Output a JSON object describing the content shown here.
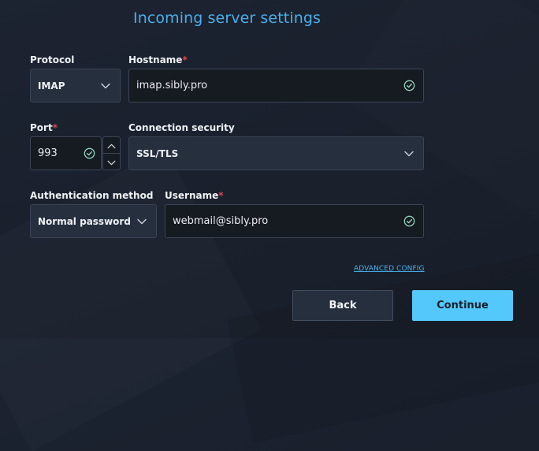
{
  "form": {
    "title": "Incoming server settings",
    "protocol": {
      "label": "Protocol",
      "value": "IMAP",
      "icon": "chevron-down-icon"
    },
    "hostname": {
      "label": "Hostname",
      "required_mark": "*",
      "value": "imap.sibly.pro",
      "status_icon": "check-circle-icon"
    },
    "port": {
      "label": "Port",
      "required_mark": "*",
      "value": "993",
      "status_icon": "check-circle-icon"
    },
    "connection_security": {
      "label": "Connection security",
      "value": "SSL/TLS",
      "icon": "chevron-down-icon"
    },
    "auth_method": {
      "label": "Authentication method",
      "value": "Normal password",
      "icon": "chevron-down-icon"
    },
    "username": {
      "label": "Username",
      "required_mark": "*",
      "value": "webmail@sibly.pro",
      "status_icon": "check-circle-icon"
    },
    "advanced_link": "ADVANCED CONFIG",
    "back_label": "Back",
    "continue_label": "Continue"
  },
  "colors": {
    "accent": "#4aaeea",
    "continue_button": "#55c8fb",
    "required": "#e0454b",
    "valid_check": "#8fd3b6",
    "background": "#1c2331"
  }
}
